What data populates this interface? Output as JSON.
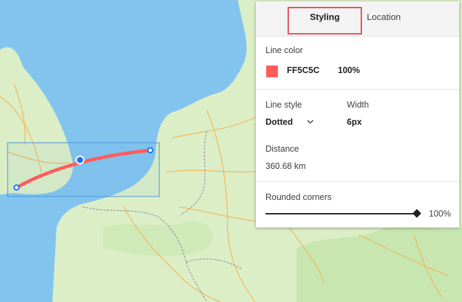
{
  "tabs": {
    "styling": "Styling",
    "location": "Location"
  },
  "line_color": {
    "label": "Line color",
    "hex": "FF5C5C",
    "swatch": "#ff5c5c",
    "opacity": "100%"
  },
  "line_style": {
    "label": "Line style",
    "value": "Dotted"
  },
  "width": {
    "label": "Width",
    "value": "6px"
  },
  "distance": {
    "label": "Distance",
    "value": "360.68 km"
  },
  "rounded_corners": {
    "label": "Rounded corners",
    "value": "100%",
    "level": 1.0
  },
  "colors": {
    "sea": "#83c4ef",
    "land": "#dbeec6",
    "route": "#ff5c5c",
    "selection": "#4a90d9",
    "handle": "#1a73e8"
  },
  "icons": {
    "dropdown": "chevron-down-icon",
    "slider_thumb": "diamond-icon",
    "map_handle": "circle-handle-icon"
  }
}
